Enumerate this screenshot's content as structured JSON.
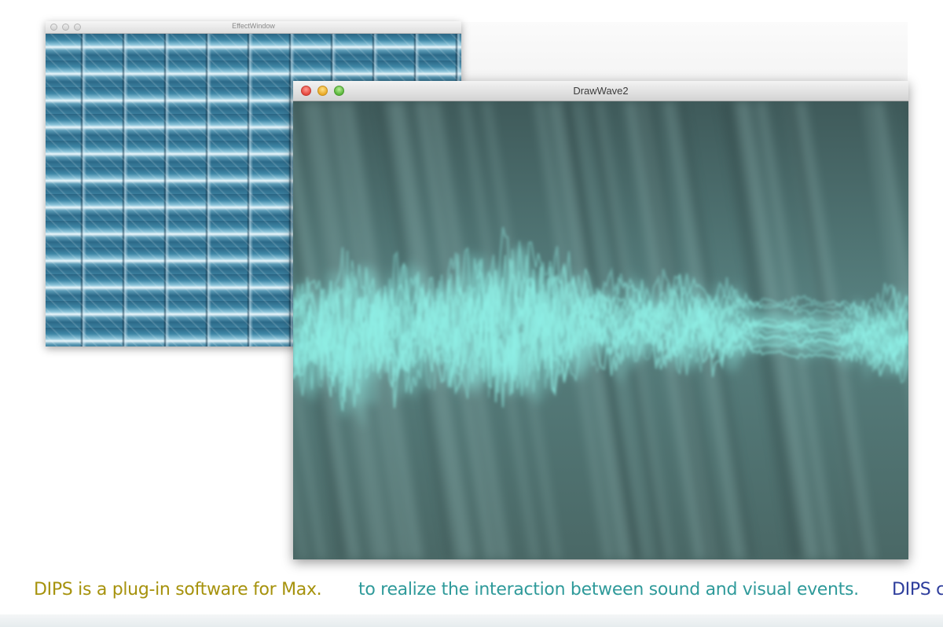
{
  "windows": {
    "effect": {
      "title": "EffectWindow"
    },
    "wave": {
      "title": "DrawWave2"
    }
  },
  "caption": {
    "part1": "DIPS is a plug-in software for Max.",
    "part2": "to realize the interaction between sound and visual events.",
    "part3": "DIPS c"
  },
  "colors": {
    "caption1": "#a6920c",
    "caption2": "#2f9a9a",
    "caption3": "#2d3d9c",
    "wave_glow": "#8ff0e6",
    "wave_background": "#4e6c6c"
  }
}
